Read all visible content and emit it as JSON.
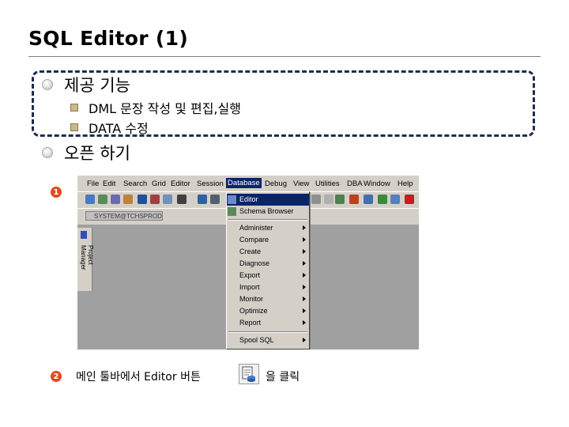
{
  "slide": {
    "title": "SQL Editor (1)",
    "bullets": [
      {
        "text": "제공 기능",
        "sub": [
          "DML 문장 작성 및 편집,실행",
          "DATA 수정"
        ]
      },
      {
        "text": "오픈 하기"
      }
    ],
    "steps": [
      {
        "number": "1"
      },
      {
        "number": "2",
        "text_before": "메인 툴바에서 Editor 버튼",
        "text_after": "을 클릭"
      }
    ]
  },
  "app": {
    "menubar": [
      "File",
      "Edit",
      "Search",
      "Grid",
      "Editor",
      "Session",
      "Database",
      "Debug",
      "View",
      "Utilities",
      "DBA",
      "Window",
      "Help"
    ],
    "active_menu": "Database",
    "connection_tab": "SYSTEM@TCHSPROD",
    "side_panel": "Project Manager",
    "database_menu": {
      "top_items": [
        "Editor",
        "Schema Browser"
      ],
      "highlighted": "Editor",
      "submenus": [
        "Administer",
        "Compare",
        "Create",
        "Diagnose",
        "Export",
        "Import",
        "Monitor",
        "Optimize",
        "Report"
      ],
      "bottom_item": "Spool SQL"
    }
  },
  "colors": {
    "highlight": "#0a246a",
    "step_badge": "#e24a1e",
    "dash_border": "#1f2d4d"
  }
}
